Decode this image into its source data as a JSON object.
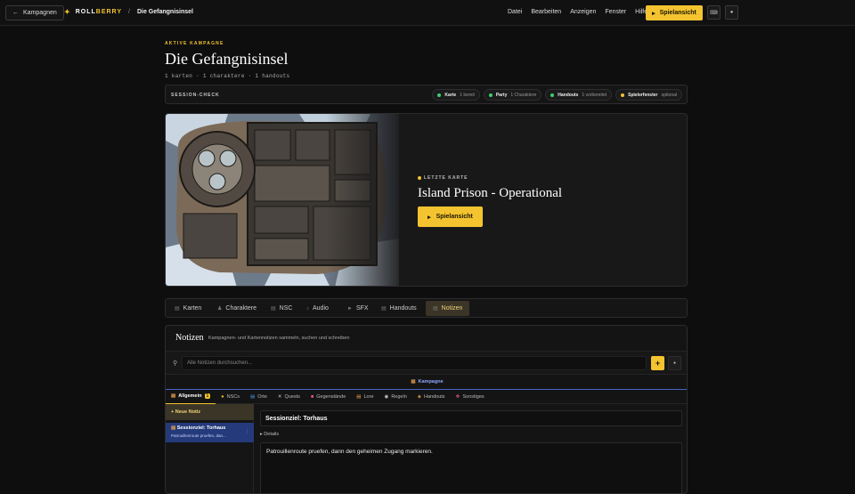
{
  "topbar": {
    "back_label": "Kampagnen",
    "brand_a": "ROLL",
    "brand_b": "BERRY",
    "separator": "/",
    "breadcrumb": "Die Gefangnisinsel",
    "menu": [
      "Datei",
      "Bearbeiten",
      "Anzeigen",
      "Fenster",
      "Hilfe"
    ],
    "play_label": "Spielansicht"
  },
  "campaign": {
    "eyebrow": "AKTIVE KAMPAGNE",
    "title": "Die Gefangnisinsel",
    "stats": "1 karten · 1 charaktere · 1 handouts"
  },
  "session_check": {
    "label": "SESSION-CHECK",
    "items": [
      {
        "name": "Karte",
        "status": "1 bereit",
        "color": "#3ecf6e"
      },
      {
        "name": "Party",
        "status": "1 Charaktere",
        "color": "#3ecf6e"
      },
      {
        "name": "Handouts",
        "status": "1 vorbereitet",
        "color": "#3ecf6e"
      },
      {
        "name": "Spielerfenster",
        "status": "optional",
        "color": "#f4c430"
      }
    ]
  },
  "hero": {
    "eyebrow": "LETZTE KARTE",
    "map_title": "Island Prison - Operational",
    "play_label": "Spielansicht"
  },
  "tabs": [
    {
      "label": "Karten",
      "icon": "map-icon",
      "active": false
    },
    {
      "label": "Charaktere",
      "icon": "user-icon",
      "active": false
    },
    {
      "label": "NSC",
      "icon": "npc-icon",
      "active": false
    },
    {
      "label": "Audio",
      "icon": "music-icon",
      "active": false
    },
    {
      "label": "SFX",
      "icon": "speaker-icon",
      "active": false
    },
    {
      "label": "Handouts",
      "icon": "document-icon",
      "active": false
    },
    {
      "label": "Notizen",
      "icon": "note-icon",
      "active": true
    }
  ],
  "notes": {
    "title": "Notizen",
    "description": "Kampagnen- und Kartennotizen sammeln, suchen und schreiben",
    "search_placeholder": "Alle Notizen durchsuchen...",
    "add_label": "+",
    "scope": "Kampagne",
    "categories": [
      {
        "label": "Allgemein",
        "count": "1",
        "active": true,
        "color": "#e8a04a"
      },
      {
        "label": "NSCs",
        "active": false,
        "color": "#f4c430"
      },
      {
        "label": "Orte",
        "active": false,
        "color": "#4a9ae8"
      },
      {
        "label": "Quests",
        "active": false,
        "color": "#cccccc"
      },
      {
        "label": "Gegenstände",
        "active": false,
        "color": "#e85a7a"
      },
      {
        "label": "Lore",
        "active": false,
        "color": "#e8a04a"
      },
      {
        "label": "Regeln",
        "active": false,
        "color": "#cccccc"
      },
      {
        "label": "Handouts",
        "active": false,
        "color": "#e8a04a"
      },
      {
        "label": "Sonstiges",
        "active": false,
        "color": "#e85a7a"
      }
    ],
    "new_note_label": "+ Neue Notiz",
    "list": [
      {
        "title": "Sessionziel: Torhaus",
        "preview": "Patrouillenroute pruefen, dan..."
      }
    ],
    "editor": {
      "title": "Sessionziel: Torhaus",
      "details_label": "▸ Details",
      "body": "Patrouillenroute pruefen, dann den geheimen Zugang markieren."
    }
  }
}
